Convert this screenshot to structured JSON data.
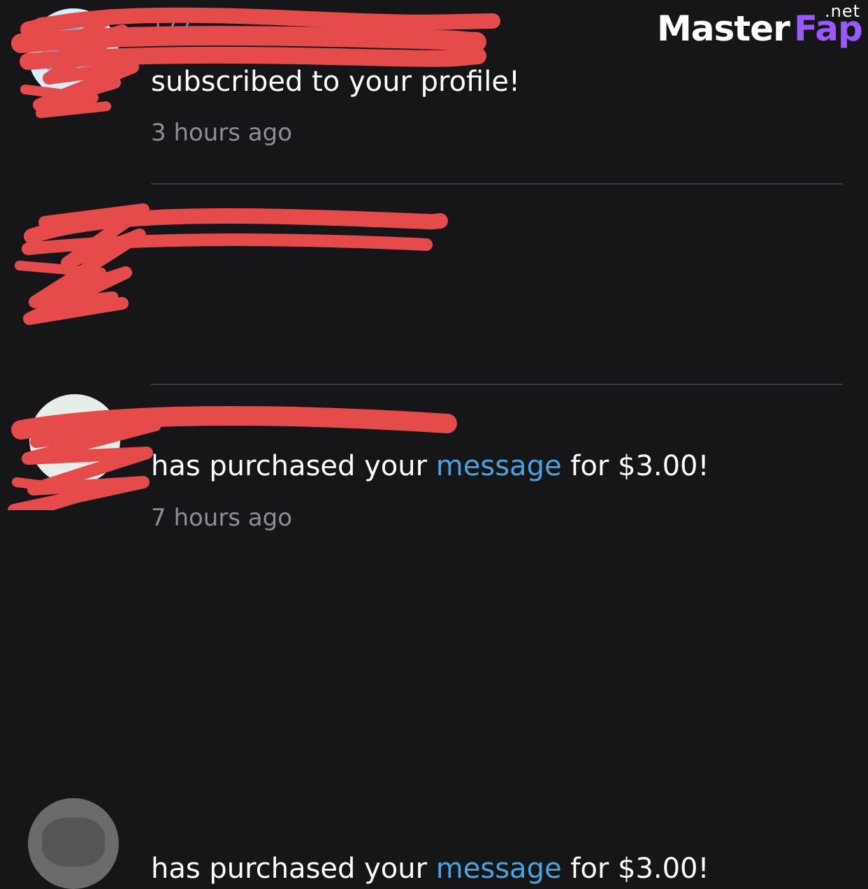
{
  "watermark": {
    "brand_primary": "Master",
    "brand_secondary": "Fap",
    "brand_tld": ".net"
  },
  "notifications": [
    {
      "username_visible_fragment": "172",
      "message": "subscribed to your profile!",
      "time": "3 hours ago",
      "avatar": "profile-avatar"
    },
    {
      "username_visible_fragment": "",
      "message_prefix": "has purchased your ",
      "message_link": "message",
      "message_suffix": " for $3.00!",
      "time": "7 hours ago",
      "avatar": "profile-avatar"
    },
    {
      "username_visible_fragment": "",
      "message_prefix": "has purchased your ",
      "message_link": "message",
      "message_suffix": " for $3.00!",
      "avatar": "profile-avatar"
    }
  ],
  "colors": {
    "background": "#161618",
    "text": "#ffffff",
    "link": "#4aa3df",
    "muted": "#8c8f93",
    "divider": "#3a3b3f",
    "redaction": "#e54b4b",
    "watermark_accent": "#9a59ff"
  }
}
